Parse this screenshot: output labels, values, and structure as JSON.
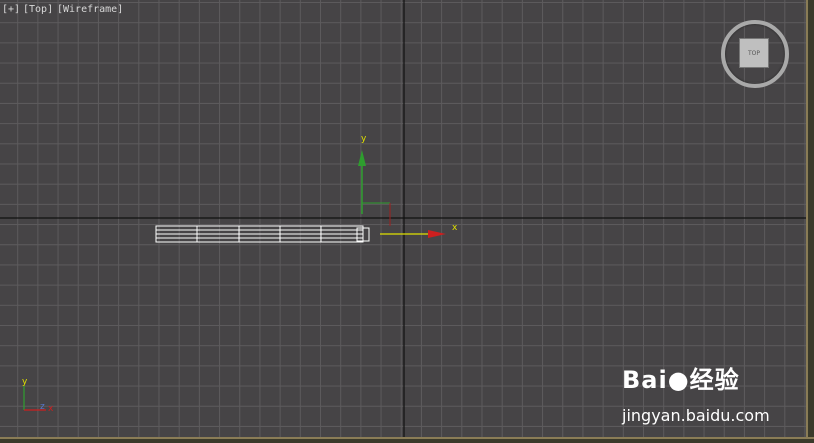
{
  "viewport": {
    "labels": [
      "[+]",
      "[Top]",
      "[Wireframe]"
    ],
    "background_color": "#464446",
    "grid_color": "#5d5b5d",
    "home_axis_color": "#111111"
  },
  "gizmo": {
    "x_label": "x",
    "y_label": "y",
    "x_color": "#e0e000",
    "y_color": "#2e9e2e",
    "z_color": "#9e1f1f"
  },
  "viewcube": {
    "face_label": "TOP"
  },
  "corner_axis": {
    "x_label": "x",
    "y_label": "y",
    "z_label": "z"
  },
  "watermark": {
    "brand": "Bai",
    "brand_suffix": "经验",
    "url": "jingyan.baidu.com"
  }
}
